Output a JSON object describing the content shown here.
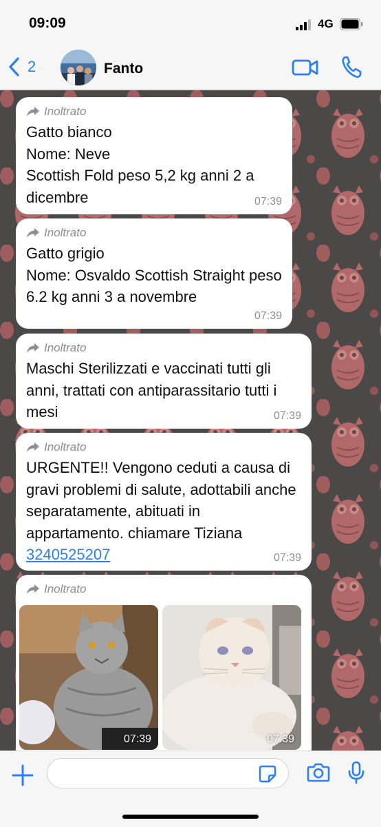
{
  "status_bar": {
    "time": "09:09",
    "network": "4G"
  },
  "nav": {
    "back_count": "2",
    "contact_name": "Fanto"
  },
  "messages": [
    {
      "forwarded_label": "Inoltrato",
      "text": "Gatto bianco\nNome: Neve\nScottish Fold peso 5,2 kg anni 2 a dicembre",
      "time": "07:39"
    },
    {
      "forwarded_label": "Inoltrato",
      "text": "Gatto grigio\nNome: Osvaldo  Scottish Straight peso 6.2 kg anni 3 a novembre",
      "time": "07:39"
    },
    {
      "forwarded_label": "Inoltrato",
      "text": "Maschi Sterilizzati e vaccinati tutti gli anni, trattati con antiparassitario tutti i mesi",
      "time": "07:39"
    },
    {
      "forwarded_label": "Inoltrato",
      "text": "URGENTE!! Vengono ceduti a causa di gravi problemi di salute, adottabili anche separatamente, abituati  in appartamento. chiamare Tiziana",
      "phone": "3240525207",
      "time": "07:39"
    },
    {
      "forwarded_label": "Inoltrato",
      "photos": [
        {
          "subject": "grey-cat-photo",
          "time": "07:39"
        },
        {
          "subject": "white-cat-photo",
          "time": "07:39"
        }
      ]
    }
  ],
  "input": {
    "placeholder": ""
  },
  "colors": {
    "accent": "#2a7ff2",
    "wallpaper_dark": "#4b4848",
    "wallpaper_owl": "#b06868",
    "bubble": "#ffffff",
    "muted": "#8e8e93"
  }
}
